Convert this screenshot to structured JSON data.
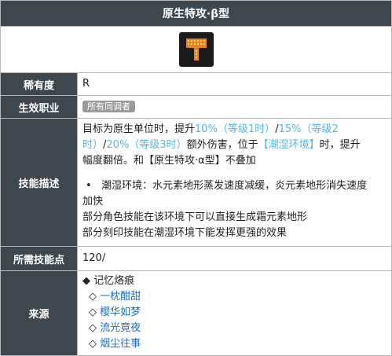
{
  "title": "原生特攻·β型",
  "icon": {
    "name": "hammer-icon",
    "color": "#e8841f"
  },
  "rows": {
    "rarity": {
      "label": "稀有度",
      "value": "R"
    },
    "job": {
      "label": "生效职业",
      "badge": "所有同调者"
    },
    "desc": {
      "label": "技能描述",
      "line1_a": "目标为原生单位时，提升",
      "line1_b": "10%（等级1时）",
      "line1_c": "/",
      "line1_d": "15%（等级2",
      "line2_a": "时）",
      "line2_b": "/",
      "line2_c": "20%（等级3时）",
      "line2_d": "额外伤害，位于",
      "line2_e": "【潮湿环境】",
      "line2_f": "时，提升",
      "line3": "幅度翻倍。和【原生特攻·α型】不叠加",
      "bullet_dot": "•",
      "line4": "潮湿环境：水元素地形蒸发速度减缓，炎元素地形消失速度",
      "line5": "加快",
      "line6": "部分角色技能在该环境下可以直接生成霜元素地形",
      "line7": "部分刻印技能在潮湿环境下能发挥更强的效果"
    },
    "points": {
      "label": "所需技能点",
      "value": "120/"
    },
    "source": {
      "label": "来源",
      "head_mark": "◆",
      "head": "记忆烙痕",
      "item_mark": "◇",
      "items": [
        "一枕酣甜",
        "樱华如梦",
        "流光竟夜",
        "烟尘往事"
      ]
    }
  }
}
